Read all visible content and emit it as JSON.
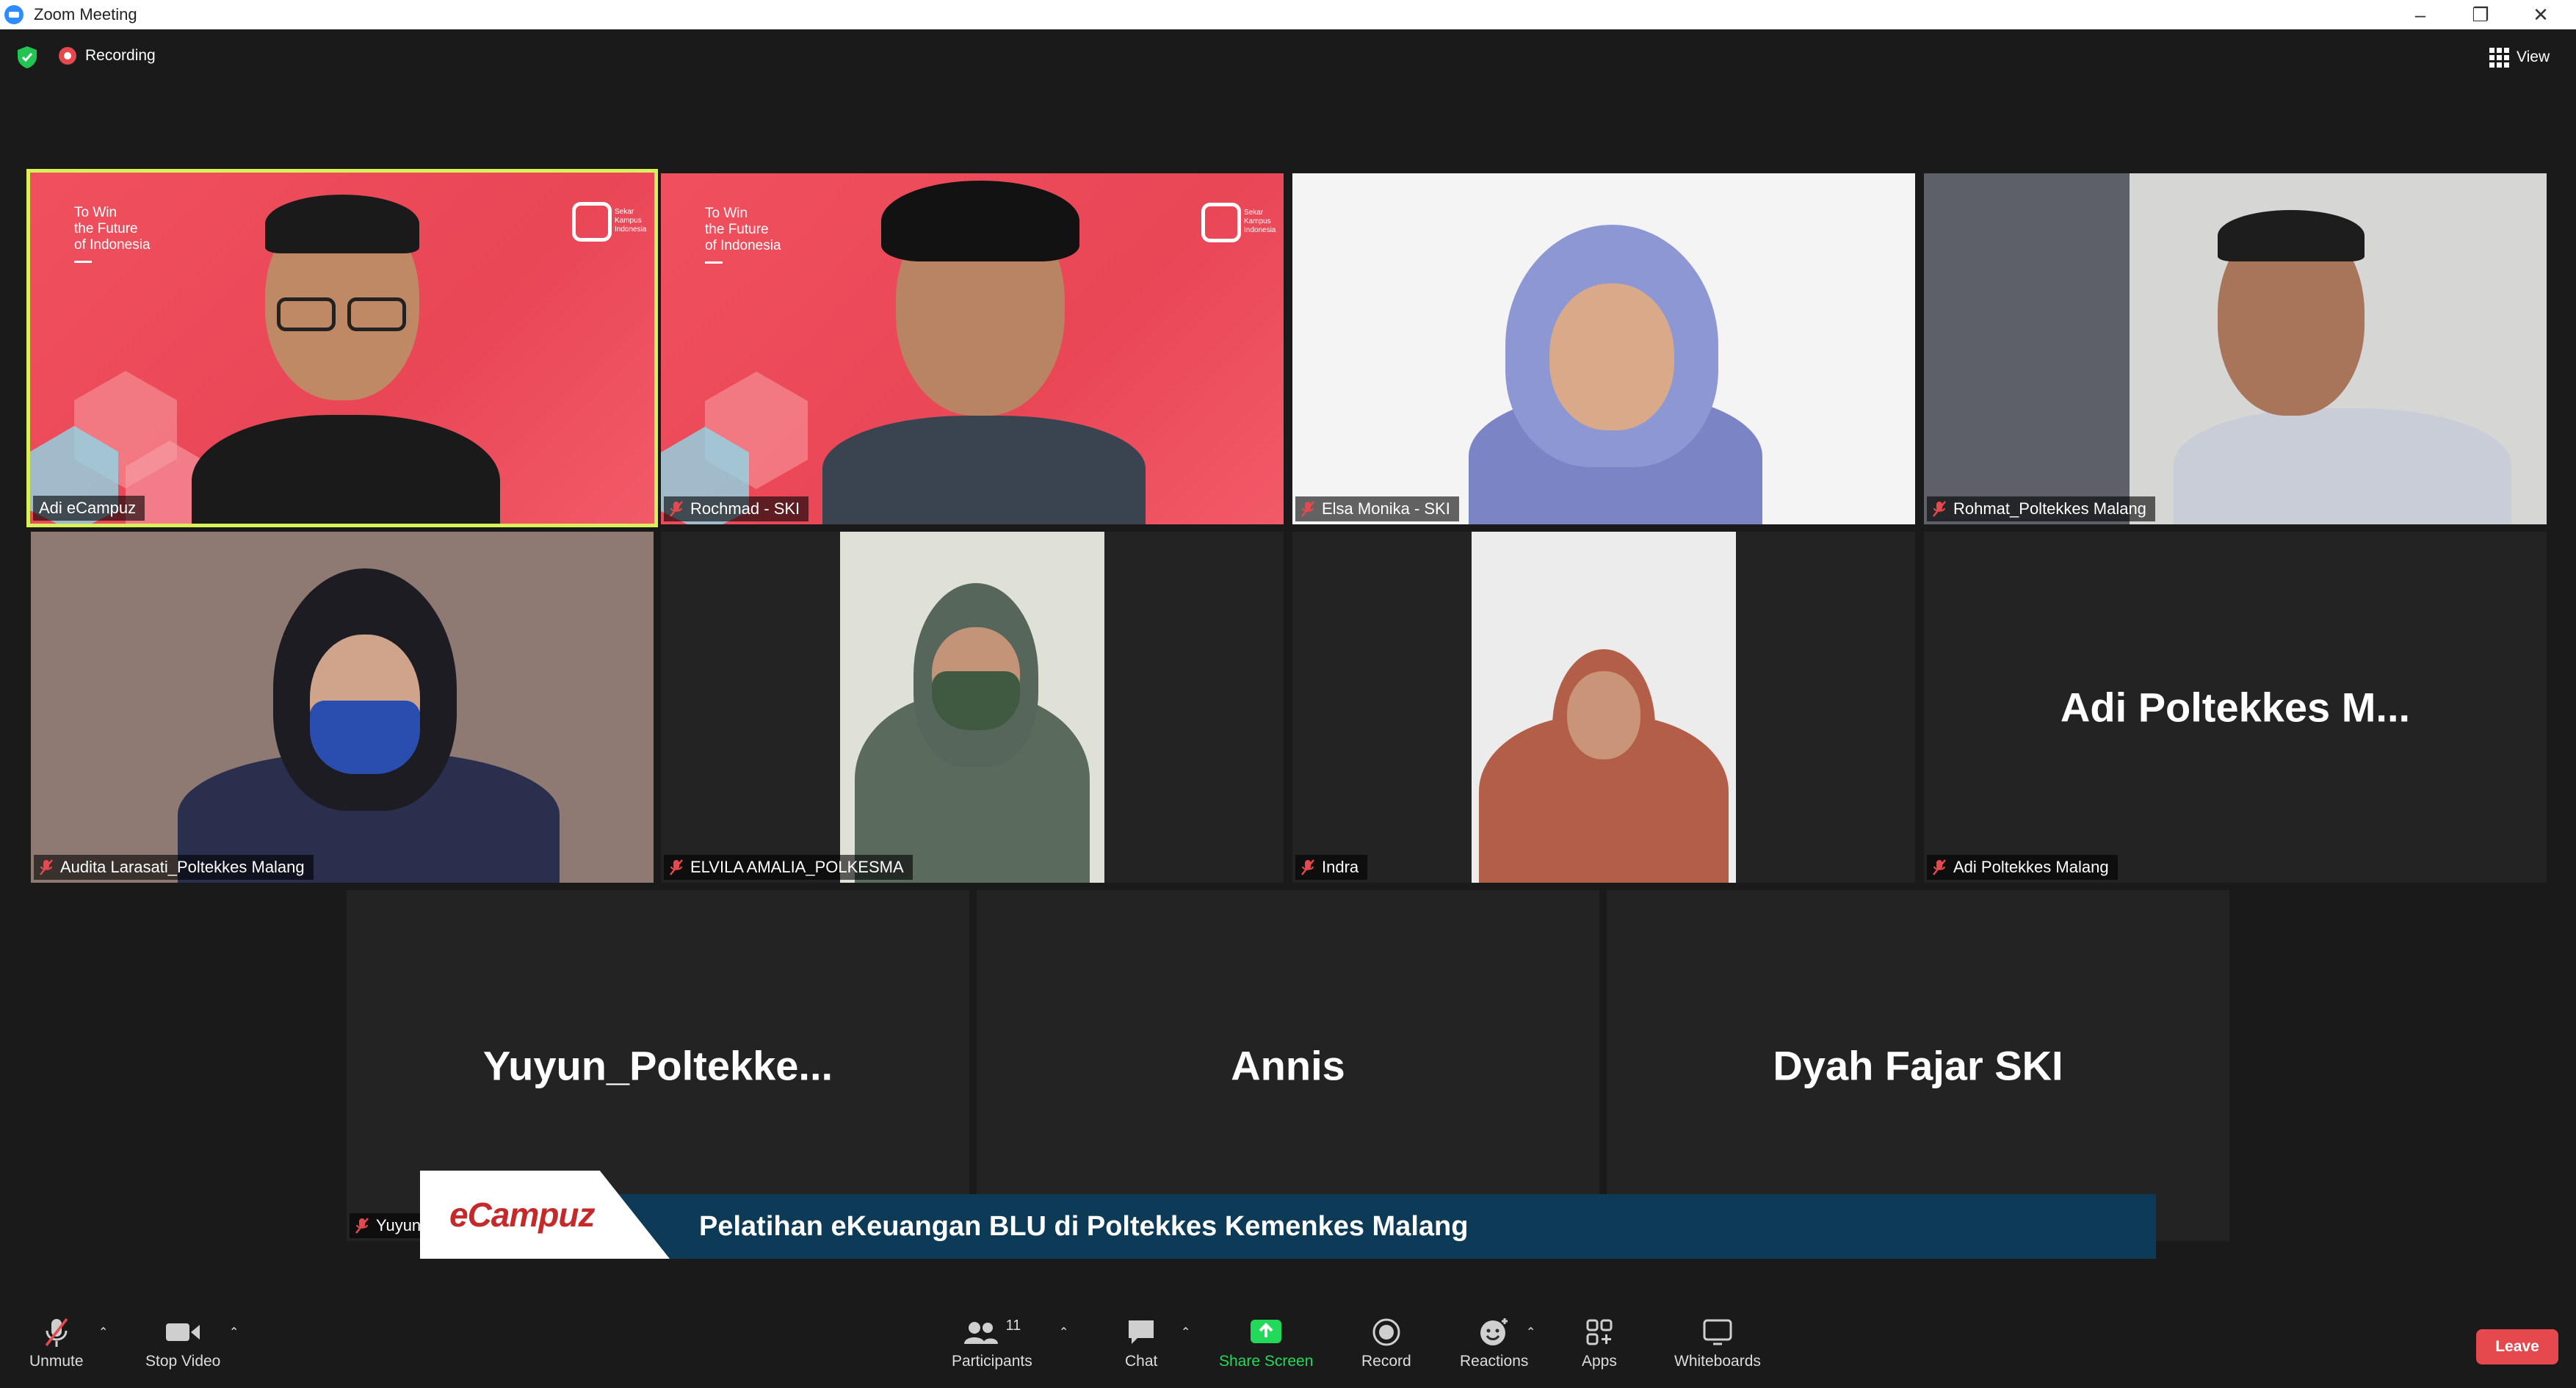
{
  "window": {
    "title": "Zoom Meeting"
  },
  "status": {
    "recording": "Recording",
    "view": "View"
  },
  "participants": [
    {
      "name": "Adi eCampuz",
      "muted": false,
      "active": true,
      "slogan": "To Win\nthe Future\nof Indonesia",
      "brand": "Sekar Kampus Indonesia"
    },
    {
      "name": "Rochmad - SKI",
      "muted": true,
      "slogan": "To Win\nthe Future\nof Indonesia",
      "brand": "Sekar Kampus Indonesia"
    },
    {
      "name": "Elsa Monika - SKI",
      "muted": true
    },
    {
      "name": "Rohmat_Poltekkes Malang",
      "muted": true
    },
    {
      "name": "Audita Larasati_Poltekkes Malang",
      "muted": true
    },
    {
      "name": "ELVILA AMALIA_POLKESMA",
      "muted": true
    },
    {
      "name": "Indra",
      "muted": true
    },
    {
      "name": "Adi Poltekkes Malang",
      "display": "Adi Poltekkes M...",
      "muted": true
    },
    {
      "display": "Yuyun_Poltekke...",
      "tag": "Yuyun"
    },
    {
      "display": "Annis"
    },
    {
      "display": "Dyah Fajar SKI"
    }
  ],
  "banner": {
    "logo": "eCampuz",
    "text": "Pelatihan eKeuangan BLU di Poltekkes Kemenkes Malang"
  },
  "toolbar": {
    "unmute": "Unmute",
    "stop_video": "Stop Video",
    "participants": "Participants",
    "participants_count": "11",
    "chat": "Chat",
    "share_screen": "Share Screen",
    "record": "Record",
    "reactions": "Reactions",
    "apps": "Apps",
    "whiteboards": "Whiteboards",
    "leave": "Leave"
  },
  "colors": {
    "active_border": "#d9f05a",
    "share_green": "#23d959",
    "leave_red": "#e5484d",
    "banner_navy": "#0d3a57"
  }
}
